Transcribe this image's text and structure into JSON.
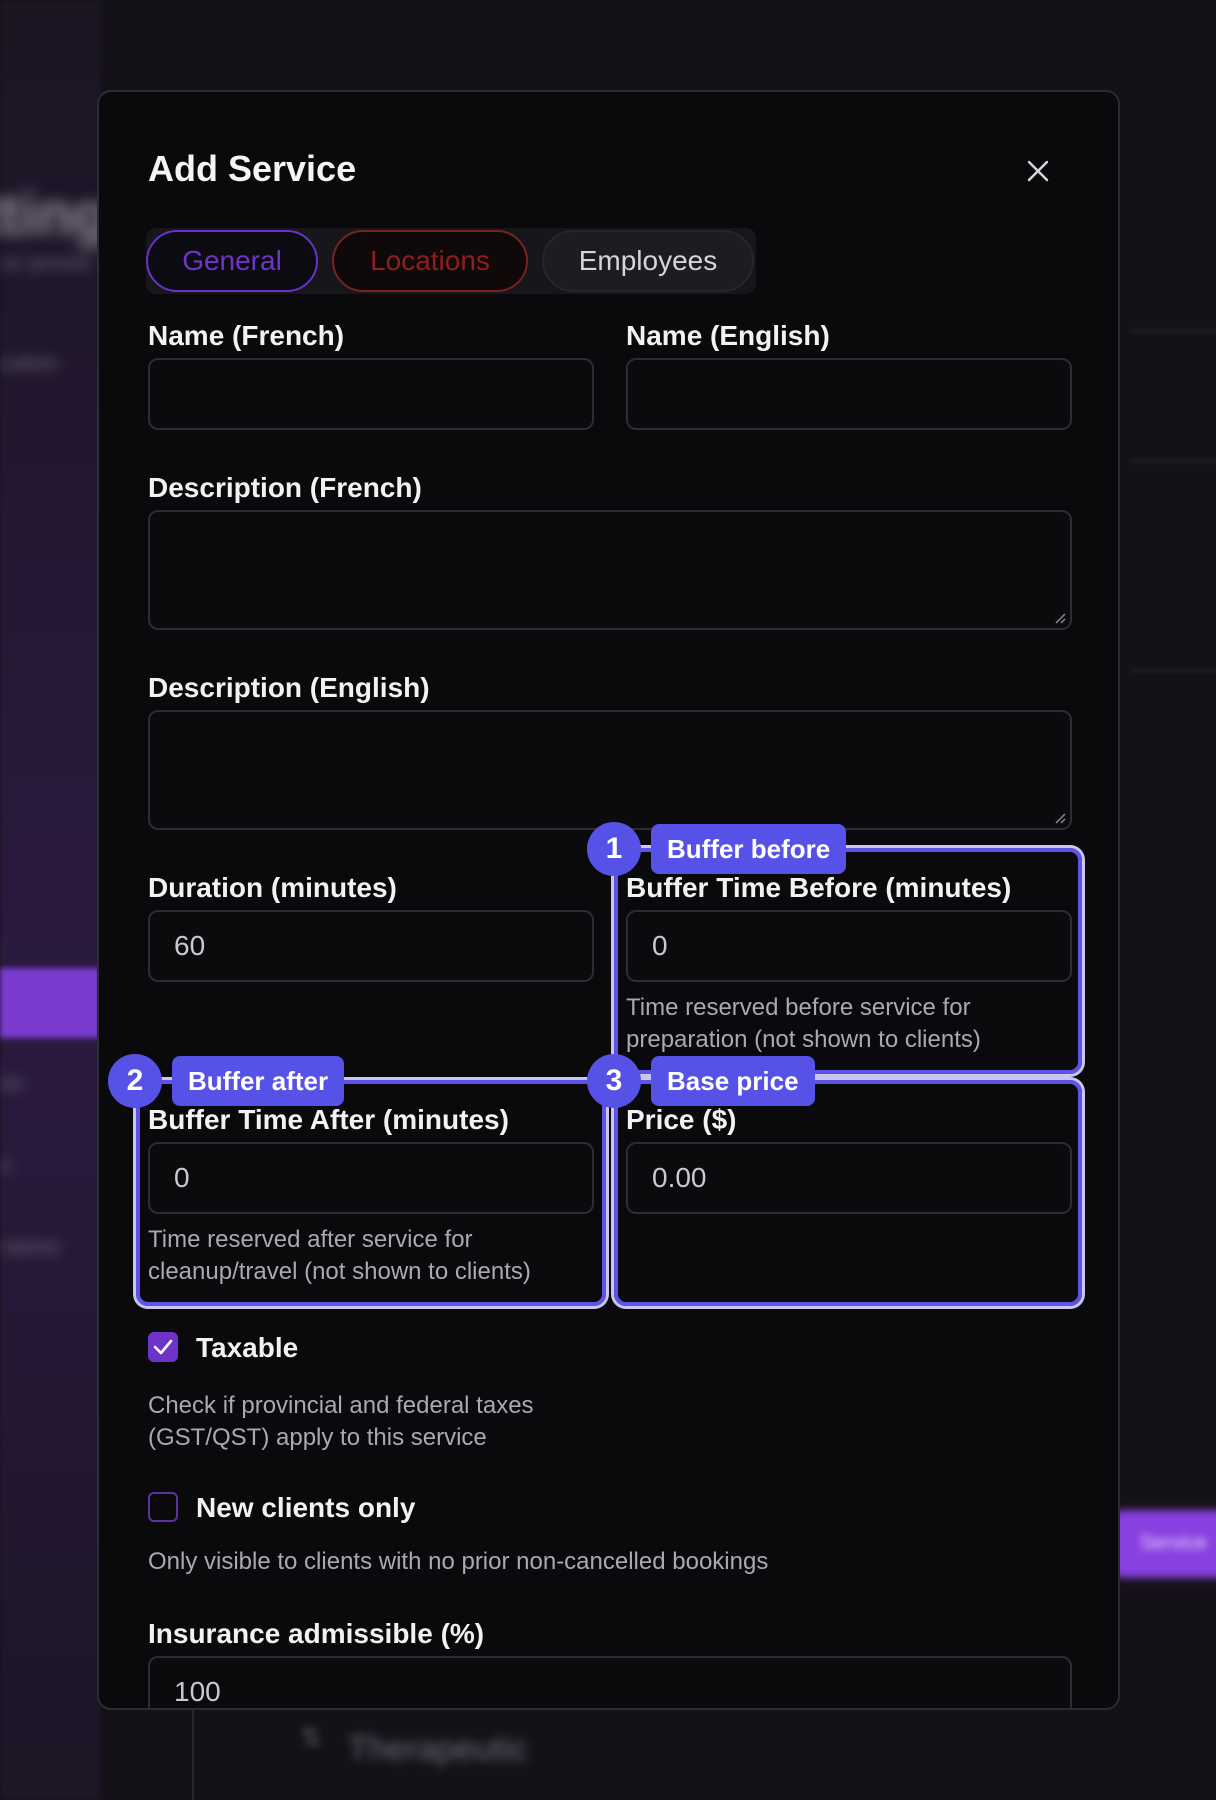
{
  "modal": {
    "title": "Add Service",
    "close_icon": "close-icon"
  },
  "tabs": [
    {
      "label": "General",
      "color": "#6e33c9"
    },
    {
      "label": "Locations",
      "color": "#8f1f1f"
    },
    {
      "label": "Employees",
      "color": "#d6d6da"
    }
  ],
  "fields": {
    "name_fr": {
      "label": "Name (French)",
      "value": ""
    },
    "name_en": {
      "label": "Name (English)",
      "value": ""
    },
    "desc_fr": {
      "label": "Description (French)",
      "value": ""
    },
    "desc_en": {
      "label": "Description (English)",
      "value": ""
    },
    "duration": {
      "label": "Duration (minutes)",
      "value": "60"
    },
    "buffer_before": {
      "label": "Buffer Time Before (minutes)",
      "value": "0",
      "help": "Time reserved before service for preparation (not shown to clients)"
    },
    "buffer_after": {
      "label": "Buffer Time After (minutes)",
      "value": "0",
      "help": "Time reserved after service for cleanup/travel (not shown to clients)"
    },
    "price": {
      "label": "Price ($)",
      "value": "0.00"
    },
    "insurance": {
      "label": "Insurance admissible (%)",
      "value": "100"
    }
  },
  "checkboxes": {
    "taxable": {
      "label": "Taxable",
      "checked": true,
      "help": "Check if provincial and federal taxes (GST/QST) apply to this service"
    },
    "new_clients": {
      "label": "New clients only",
      "checked": false,
      "help": "Only visible to clients with no prior non-cancelled bookings"
    }
  },
  "annotations": [
    {
      "number": "1",
      "tag": "Buffer before"
    },
    {
      "number": "2",
      "tag": "Buffer after"
    },
    {
      "number": "3",
      "tag": "Base price"
    }
  ],
  "colors": {
    "accent": "#6e33c9",
    "annotation": "#5652e8",
    "background": "#0a0a0c"
  }
}
